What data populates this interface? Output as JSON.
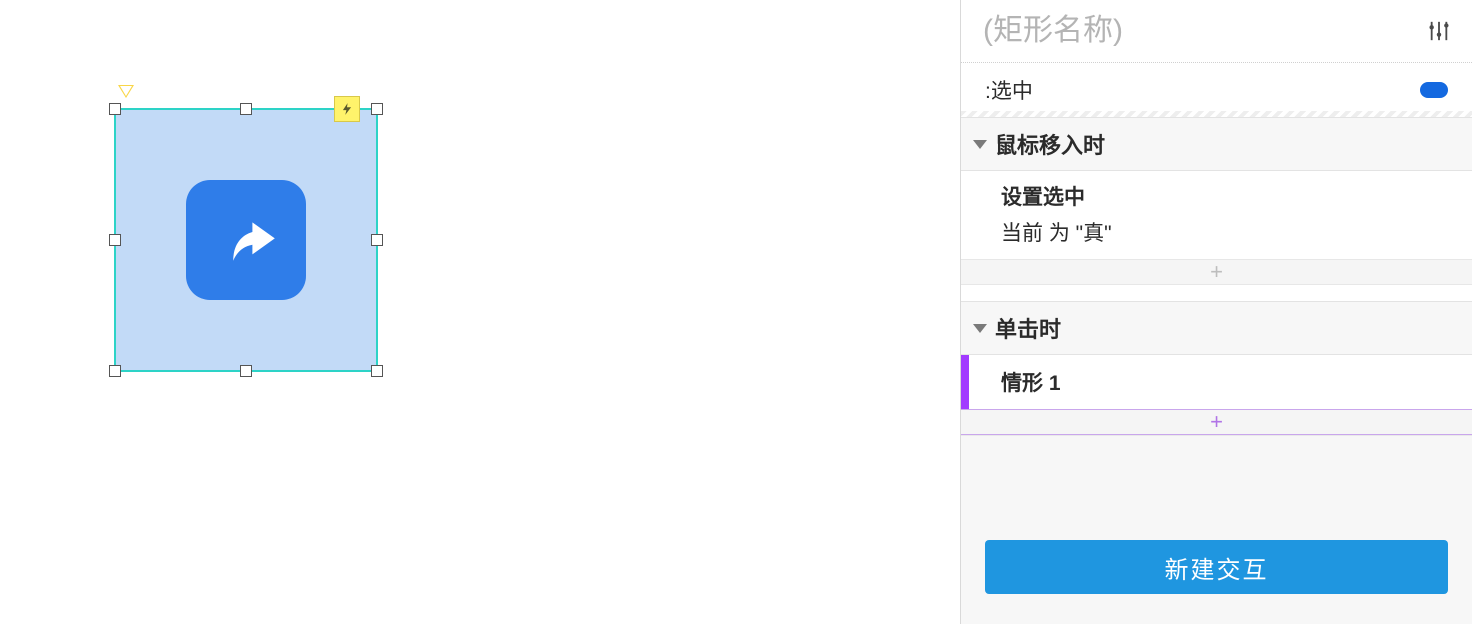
{
  "panel": {
    "name_placeholder": "(矩形名称)",
    "state_label": ":选中",
    "events": [
      {
        "title": "鼠标移入时",
        "action_title": "设置选中",
        "action_detail": "当前 为 \"真\""
      },
      {
        "title": "单击时",
        "case_label": "情形 1"
      }
    ],
    "new_interaction_label": "新建交互"
  }
}
